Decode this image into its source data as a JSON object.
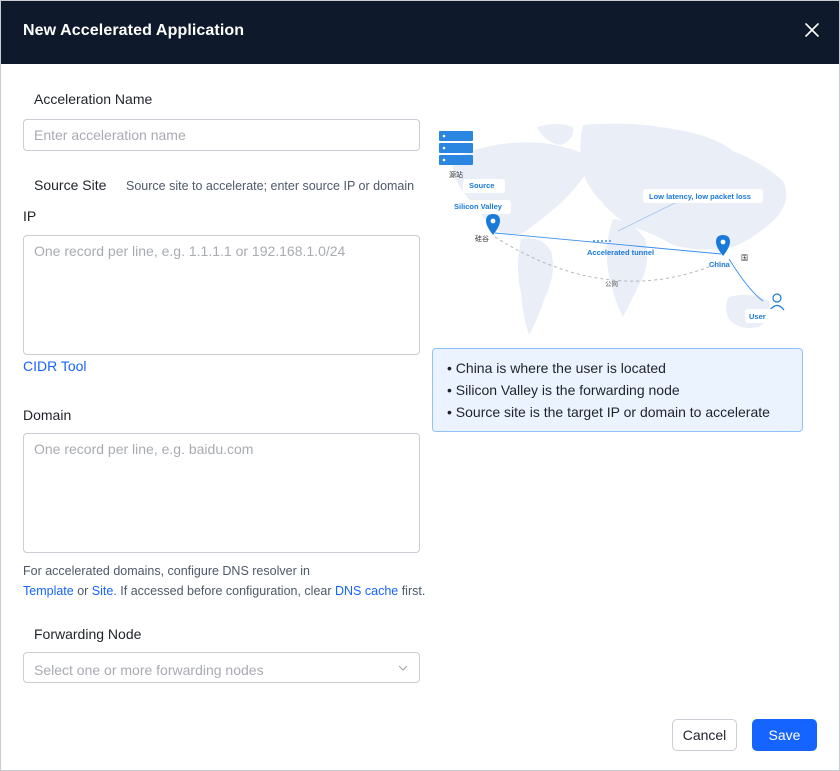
{
  "dialog": {
    "title": "New Accelerated Application",
    "close_label": "×"
  },
  "form": {
    "acceleration_name": {
      "label": "Acceleration Name",
      "placeholder": "Enter acceleration name",
      "value": ""
    },
    "source_site": {
      "label": "Source Site",
      "hint": "Source site to accelerate; enter source IP or domain"
    },
    "ip": {
      "label": "IP",
      "placeholder": "One record per line, e.g. 1.1.1.1 or 192.168.1.0/24",
      "value": "",
      "cidr_tool_link": "CIDR Tool"
    },
    "domain": {
      "label": "Domain",
      "placeholder": "One record per line, e.g. baidu.com",
      "value": "",
      "note_part1": "For accelerated domains, configure DNS resolver in",
      "template_link": "Template",
      "or_text": " or ",
      "site_link": "Site",
      "note_part2": ". If accessed before configuration, clear ",
      "dns_cache_link": "DNS cache",
      "note_part3": " first."
    },
    "forwarding_node": {
      "label": "Forwarding Node",
      "placeholder": "Select one or more forwarding nodes"
    }
  },
  "diagram": {
    "server_label": "源站",
    "source_label": "Source",
    "silicon_valley_label": "Silicon Valley",
    "silicon_valley_cn": "硅谷",
    "low_latency_label": "Low latency, low packet loss",
    "accelerated_tunnel_label": "Accelerated tunnel",
    "china_label": "China",
    "china_cn": "国",
    "public_net_label": "公网",
    "user_label": "User"
  },
  "info_box": {
    "lines": [
      "China is where the user is located",
      "Silicon Valley is the forwarding node",
      "Source site is the target IP or domain to accelerate"
    ]
  },
  "footer": {
    "cancel_label": "Cancel",
    "save_label": "Save"
  },
  "colors": {
    "header_bg": "#0e1a2b",
    "primary": "#1664ff",
    "info_bg": "#eaf3ff",
    "info_border": "#92c0ff",
    "map_land": "#e9eef7",
    "diagram_blue": "#1a7ad9"
  },
  "icons": [
    "close-icon",
    "chevron-down-icon",
    "server-icon",
    "location-pin-icon",
    "user-icon"
  ]
}
